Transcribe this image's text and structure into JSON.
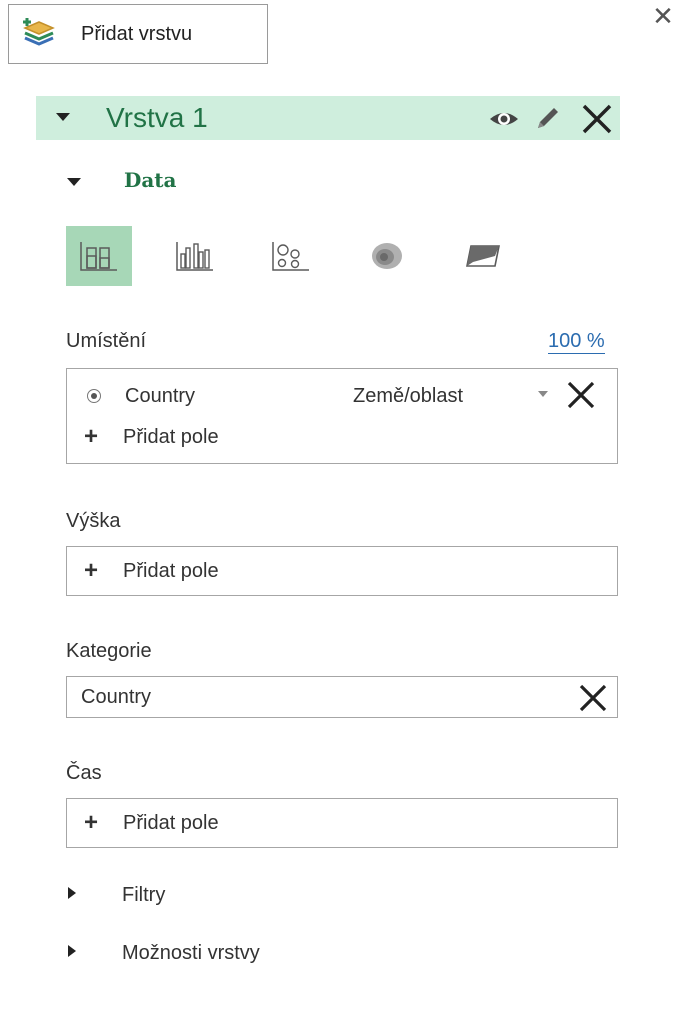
{
  "toolbar": {
    "add_layer_label": "Přidat vrstvu",
    "close_symbol": "✕"
  },
  "layer": {
    "name": "Vrstva 1"
  },
  "data_section": {
    "title": "Data",
    "viz_types": [
      {
        "icon": "stacked-column-icon",
        "active": true
      },
      {
        "icon": "clustered-column-icon",
        "active": false
      },
      {
        "icon": "bubble-icon",
        "active": false
      },
      {
        "icon": "heat-map-icon",
        "active": false
      },
      {
        "icon": "region-icon",
        "active": false
      }
    ]
  },
  "location": {
    "label": "Umístění",
    "percent": "100 %",
    "field": "Country",
    "field_type": "Země/oblast",
    "add_field": "Přidat pole"
  },
  "height": {
    "label": "Výška",
    "add_field": "Přidat pole"
  },
  "category": {
    "label": "Kategorie",
    "field": "Country"
  },
  "time": {
    "label": "Čas",
    "add_field": "Přidat pole"
  },
  "filters": {
    "label": "Filtry"
  },
  "layer_options": {
    "label": "Možnosti vrstvy"
  },
  "colors": {
    "accent_green": "#217346",
    "header_bg": "#cfeedd",
    "active_viz_bg": "#a7d7b7",
    "link_blue": "#2b6cb0"
  }
}
